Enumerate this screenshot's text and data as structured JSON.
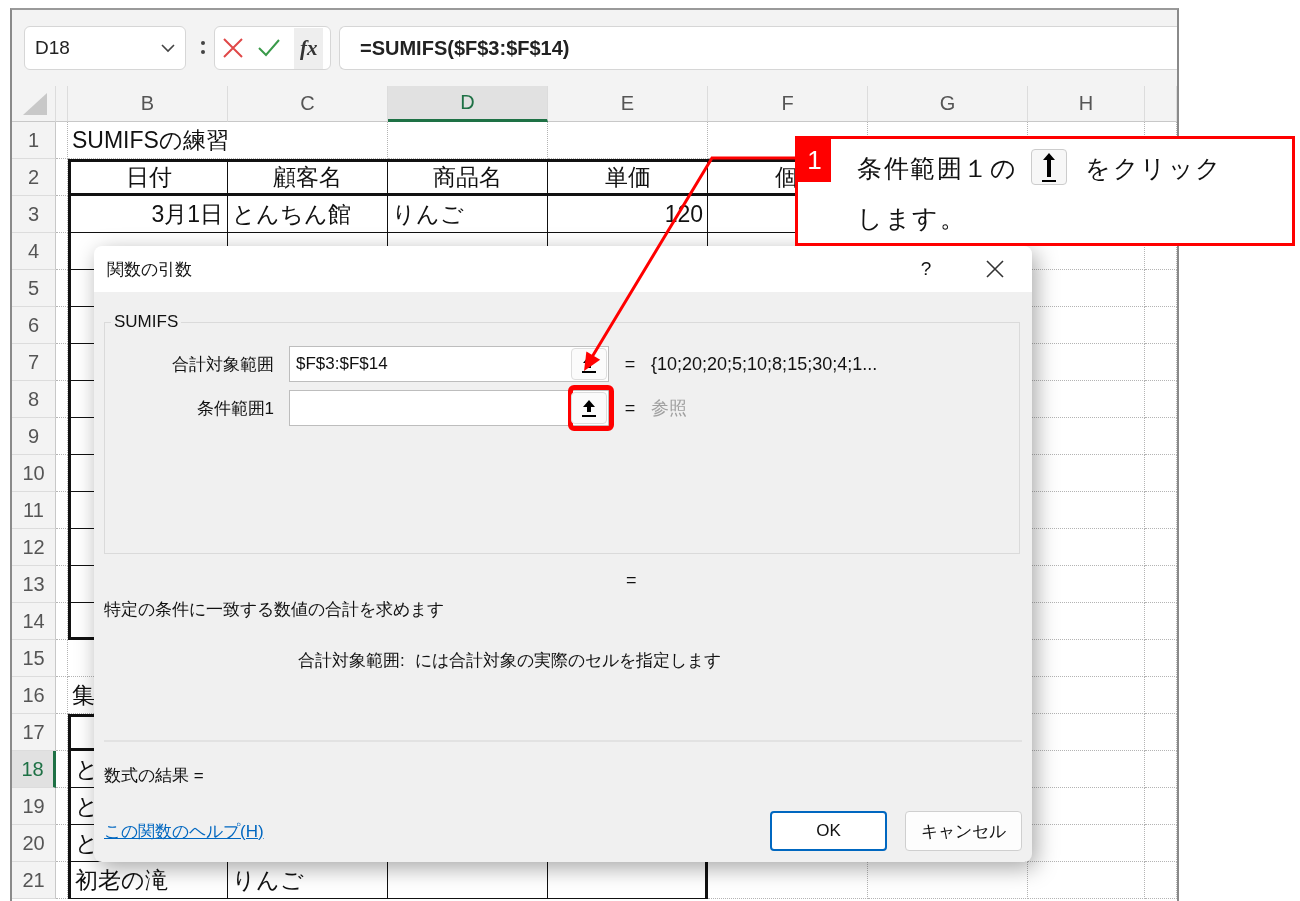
{
  "formula_bar": {
    "name_box": "D18",
    "fx_label": "fx",
    "formula": "=SUMIFS($F$3:$F$14)"
  },
  "sheet": {
    "columns": [
      {
        "label": "B",
        "selected": false
      },
      {
        "label": "C",
        "selected": false
      },
      {
        "label": "D",
        "selected": true
      },
      {
        "label": "E",
        "selected": false
      },
      {
        "label": "F",
        "selected": false
      },
      {
        "label": "G",
        "selected": false
      },
      {
        "label": "H",
        "selected": false
      }
    ],
    "rows": [
      {
        "number": "1",
        "selected": false,
        "cells": {
          "b": {
            "text": "SUMIFSの練習",
            "kind": "text"
          }
        }
      },
      {
        "number": "2",
        "selected": false,
        "cells": {
          "b": {
            "text": "日付",
            "kind": "header"
          },
          "c": {
            "text": "顧客名",
            "kind": "header"
          },
          "d": {
            "text": "商品名",
            "kind": "header"
          },
          "e": {
            "text": "単価",
            "kind": "header"
          },
          "f": {
            "text": "個",
            "kind": "header"
          }
        }
      },
      {
        "number": "3",
        "selected": false,
        "cells": {
          "b": {
            "text": "3月1日",
            "kind": "date"
          },
          "c": {
            "text": "とんちん館",
            "kind": "text"
          },
          "d": {
            "text": "りんご",
            "kind": "text"
          },
          "e": {
            "text": "120",
            "kind": "number"
          }
        }
      },
      {
        "number": "4",
        "selected": false,
        "cells": {}
      },
      {
        "number": "5",
        "selected": false,
        "cells": {}
      },
      {
        "number": "6",
        "selected": false,
        "cells": {}
      },
      {
        "number": "7",
        "selected": false,
        "cells": {}
      },
      {
        "number": "8",
        "selected": false,
        "cells": {}
      },
      {
        "number": "9",
        "selected": false,
        "cells": {}
      },
      {
        "number": "10",
        "selected": false,
        "cells": {}
      },
      {
        "number": "11",
        "selected": false,
        "cells": {}
      },
      {
        "number": "12",
        "selected": false,
        "cells": {}
      },
      {
        "number": "13",
        "selected": false,
        "cells": {}
      },
      {
        "number": "14",
        "selected": false,
        "cells": {}
      },
      {
        "number": "15",
        "selected": false,
        "cells": {}
      },
      {
        "number": "16",
        "selected": false,
        "cells": {
          "b": {
            "text": "集",
            "kind": "text"
          }
        }
      },
      {
        "number": "17",
        "selected": false,
        "cells": {}
      },
      {
        "number": "18",
        "selected": true,
        "cells": {
          "b": {
            "text": "と",
            "kind": "text"
          }
        }
      },
      {
        "number": "19",
        "selected": false,
        "cells": {
          "b": {
            "text": "と",
            "kind": "text"
          }
        }
      },
      {
        "number": "20",
        "selected": false,
        "cells": {
          "b": {
            "text": "と",
            "kind": "text"
          }
        }
      },
      {
        "number": "21",
        "selected": false,
        "cells": {
          "b": {
            "text": "初老の滝",
            "kind": "text"
          },
          "c": {
            "text": "りんご",
            "kind": "text"
          }
        }
      }
    ]
  },
  "dialog": {
    "title": "関数の引数",
    "help_button": "?",
    "function_name": "SUMIFS",
    "arguments": [
      {
        "label": "合計対象範囲",
        "value": "$F$3:$F$14",
        "equals": "=",
        "result": "{10;20;20;5;10;8;15;30;4;1...",
        "kind": "value",
        "highlighted": false
      },
      {
        "label": "条件範囲1",
        "equals": "=",
        "result": "参照",
        "kind": "hint",
        "highlighted": true
      }
    ],
    "formula_equals": "=",
    "description": "特定の条件に一致する数値の合計を求めます",
    "argument_help": {
      "name": "合計対象範囲:",
      "text": "には合計対象の実際のセルを指定します"
    },
    "result_label": "数式の結果 =",
    "help_link": "この関数のヘルプ(H)",
    "buttons": [
      {
        "label": "OK",
        "default": true
      },
      {
        "label": "キャンセル",
        "default": false
      }
    ]
  },
  "callout": {
    "step": "1",
    "text_before": "条件範囲１の",
    "text_after": "をクリック",
    "text_line2": "します。"
  }
}
